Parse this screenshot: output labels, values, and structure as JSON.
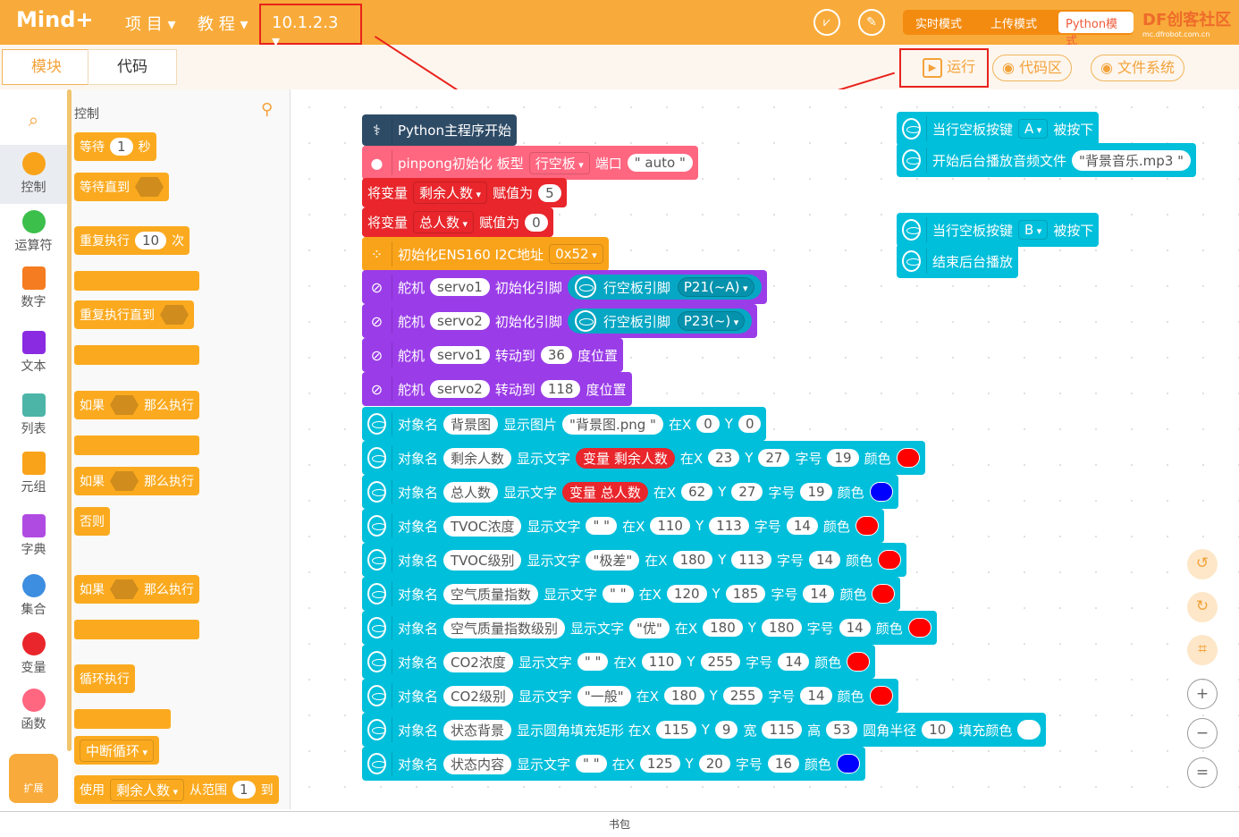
{
  "topbar": {
    "logo": "Mind+",
    "menu_project": "项 目 ▾",
    "menu_tutorial": "教 程 ▾",
    "version": "10.1.2.3 ▾",
    "modes": [
      "实时模式",
      "上传模式",
      "Python模式"
    ],
    "brand": "DF创客社区",
    "brand_url": "mc.dfrobot.com.cn"
  },
  "tabs": {
    "blocks": "模块",
    "code": "代码"
  },
  "toolbar": {
    "run": "运行",
    "code_area": "代码区",
    "file_system": "文件系统"
  },
  "categories": [
    {
      "label": "控制",
      "color": "#f9a31a"
    },
    {
      "label": "运算符",
      "color": "#3cbf4b"
    },
    {
      "label": "数字",
      "color": "#f57c20"
    },
    {
      "label": "文本",
      "color": "#8a2be2"
    },
    {
      "label": "列表",
      "color": "#4cb5a8"
    },
    {
      "label": "元组",
      "color": "#f9a31a"
    },
    {
      "label": "字典",
      "color": "#b04be2"
    },
    {
      "label": "集合",
      "color": "#3d8ee0"
    },
    {
      "label": "变量",
      "color": "#e8262b"
    },
    {
      "label": "函数",
      "color": "#ff6680"
    }
  ],
  "extensions_label": "扩展",
  "flyout": {
    "title": "控制",
    "blocks": [
      [
        {
          "t": "等待"
        },
        {
          "v": "1"
        },
        {
          "t": "秒"
        }
      ],
      [
        {
          "t": "等待直到"
        },
        {
          "h": ""
        }
      ],
      [
        {
          "t": "重复执行"
        },
        {
          "v": "10"
        },
        {
          "t": "次"
        }
      ],
      [
        {
          "t": "重复执行直到"
        },
        {
          "h": ""
        }
      ],
      [
        {
          "t": "如果"
        },
        {
          "h": ""
        },
        {
          "t": "那么执行"
        }
      ],
      [
        {
          "t": "如果"
        },
        {
          "h": ""
        },
        {
          "t": "那么执行"
        }
      ],
      [
        {
          "t": "否则"
        }
      ],
      [
        {
          "t": "如果"
        },
        {
          "h": ""
        },
        {
          "t": "那么执行"
        }
      ],
      [
        {
          "t": "循环执行"
        }
      ],
      [
        {
          "d": "中断循环"
        }
      ],
      [
        {
          "t": "使用"
        },
        {
          "d": "剩余人数"
        },
        {
          "t": "从范围"
        },
        {
          "v": "1"
        },
        {
          "t": "到"
        }
      ]
    ]
  },
  "colors": {
    "python": "#2e4b66",
    "pinpong": "#ff6680",
    "variable": "#e8262b",
    "ens": "#f9a31a",
    "servo": "#9a3ce8",
    "unihiker": "#00bfdb",
    "red": "#ff0000",
    "blue": "#0000ff",
    "white": "#ffffff"
  },
  "script": [
    {
      "kind": "python",
      "icon": "python-icon",
      "parts": [
        {
          "t": "Python主程序开始"
        }
      ]
    },
    {
      "kind": "pinpong",
      "icon": "pinpong-icon",
      "parts": [
        {
          "t": "pinpong初始化 板型"
        },
        {
          "d": "行空板"
        },
        {
          "t": "端口"
        },
        {
          "v": "\" auto \""
        }
      ]
    },
    {
      "kind": "variable",
      "parts": [
        {
          "t": "将变量"
        },
        {
          "d": "剩余人数"
        },
        {
          "t": "赋值为"
        },
        {
          "v": "5"
        }
      ]
    },
    {
      "kind": "variable",
      "parts": [
        {
          "t": "将变量"
        },
        {
          "d": "总人数"
        },
        {
          "t": "赋值为"
        },
        {
          "v": "0"
        }
      ]
    },
    {
      "kind": "ens",
      "icon": "sensor-icon",
      "parts": [
        {
          "t": "初始化ENS160 I2C地址"
        },
        {
          "d": "0x52"
        }
      ]
    },
    {
      "kind": "servo",
      "icon": "servo-icon",
      "parts": [
        {
          "t": "舵机"
        },
        {
          "v": "servo1"
        },
        {
          "t": "初始化引脚"
        },
        {
          "s": [
            "行空板引脚",
            "P21(~A)"
          ]
        }
      ]
    },
    {
      "kind": "servo",
      "icon": "servo-icon",
      "parts": [
        {
          "t": "舵机"
        },
        {
          "v": "servo2"
        },
        {
          "t": "初始化引脚"
        },
        {
          "s": [
            "行空板引脚",
            "P23(~)"
          ]
        }
      ]
    },
    {
      "kind": "servo",
      "icon": "servo-icon",
      "parts": [
        {
          "t": "舵机"
        },
        {
          "v": "servo1"
        },
        {
          "t": "转动到"
        },
        {
          "v": "36"
        },
        {
          "t": "度位置"
        }
      ]
    },
    {
      "kind": "servo",
      "icon": "servo-icon",
      "parts": [
        {
          "t": "舵机"
        },
        {
          "v": "servo2"
        },
        {
          "t": "转动到"
        },
        {
          "v": "118"
        },
        {
          "t": "度位置"
        }
      ]
    },
    {
      "kind": "unihiker",
      "icon": "unihiker-icon",
      "parts": [
        {
          "t": "对象名"
        },
        {
          "v": "背景图"
        },
        {
          "t": "显示图片"
        },
        {
          "v": "\"背景图.png \""
        },
        {
          "t": "在X"
        },
        {
          "v": "0"
        },
        {
          "t": "Y"
        },
        {
          "v": "0"
        }
      ]
    },
    {
      "kind": "unihiker",
      "icon": "unihiker-icon",
      "parts": [
        {
          "t": "对象名"
        },
        {
          "v": "剩余人数"
        },
        {
          "t": "显示文字"
        },
        {
          "r": "变量 剩余人数"
        },
        {
          "t": "在X"
        },
        {
          "v": "23"
        },
        {
          "t": "Y"
        },
        {
          "v": "27"
        },
        {
          "t": "字号"
        },
        {
          "v": "19"
        },
        {
          "t": "颜色"
        },
        {
          "c": "#ff0000"
        }
      ]
    },
    {
      "kind": "unihiker",
      "icon": "unihiker-icon",
      "parts": [
        {
          "t": "对象名"
        },
        {
          "v": "总人数"
        },
        {
          "t": "显示文字"
        },
        {
          "r": "变量 总人数"
        },
        {
          "t": "在X"
        },
        {
          "v": "62"
        },
        {
          "t": "Y"
        },
        {
          "v": "27"
        },
        {
          "t": "字号"
        },
        {
          "v": "19"
        },
        {
          "t": "颜色"
        },
        {
          "c": "#0000ff"
        }
      ]
    },
    {
      "kind": "unihiker",
      "icon": "unihiker-icon",
      "parts": [
        {
          "t": "对象名"
        },
        {
          "v": "TVOC浓度"
        },
        {
          "t": "显示文字"
        },
        {
          "v": "\"  \""
        },
        {
          "t": "在X"
        },
        {
          "v": "110"
        },
        {
          "t": "Y"
        },
        {
          "v": "113"
        },
        {
          "t": "字号"
        },
        {
          "v": "14"
        },
        {
          "t": "颜色"
        },
        {
          "c": "#ff0000"
        }
      ]
    },
    {
      "kind": "unihiker",
      "icon": "unihiker-icon",
      "parts": [
        {
          "t": "对象名"
        },
        {
          "v": "TVOC级别"
        },
        {
          "t": "显示文字"
        },
        {
          "v": "\"极差\""
        },
        {
          "t": "在X"
        },
        {
          "v": "180"
        },
        {
          "t": "Y"
        },
        {
          "v": "113"
        },
        {
          "t": "字号"
        },
        {
          "v": "14"
        },
        {
          "t": "颜色"
        },
        {
          "c": "#ff0000"
        }
      ]
    },
    {
      "kind": "unihiker",
      "icon": "unihiker-icon",
      "parts": [
        {
          "t": "对象名"
        },
        {
          "v": "空气质量指数"
        },
        {
          "t": "显示文字"
        },
        {
          "v": "\"  \""
        },
        {
          "t": "在X"
        },
        {
          "v": "120"
        },
        {
          "t": "Y"
        },
        {
          "v": "185"
        },
        {
          "t": "字号"
        },
        {
          "v": "14"
        },
        {
          "t": "颜色"
        },
        {
          "c": "#ff0000"
        }
      ]
    },
    {
      "kind": "unihiker",
      "icon": "unihiker-icon",
      "parts": [
        {
          "t": "对象名"
        },
        {
          "v": "空气质量指数级别"
        },
        {
          "t": "显示文字"
        },
        {
          "v": "\"优\""
        },
        {
          "t": "在X"
        },
        {
          "v": "180"
        },
        {
          "t": "Y"
        },
        {
          "v": "180"
        },
        {
          "t": "字号"
        },
        {
          "v": "14"
        },
        {
          "t": "颜色"
        },
        {
          "c": "#ff0000"
        }
      ]
    },
    {
      "kind": "unihiker",
      "icon": "unihiker-icon",
      "parts": [
        {
          "t": "对象名"
        },
        {
          "v": "CO2浓度"
        },
        {
          "t": "显示文字"
        },
        {
          "v": "\"  \""
        },
        {
          "t": "在X"
        },
        {
          "v": "110"
        },
        {
          "t": "Y"
        },
        {
          "v": "255"
        },
        {
          "t": "字号"
        },
        {
          "v": "14"
        },
        {
          "t": "颜色"
        },
        {
          "c": "#ff0000"
        }
      ]
    },
    {
      "kind": "unihiker",
      "icon": "unihiker-icon",
      "parts": [
        {
          "t": "对象名"
        },
        {
          "v": "CO2级别"
        },
        {
          "t": "显示文字"
        },
        {
          "v": "\"一般\""
        },
        {
          "t": "在X"
        },
        {
          "v": "180"
        },
        {
          "t": "Y"
        },
        {
          "v": "255"
        },
        {
          "t": "字号"
        },
        {
          "v": "14"
        },
        {
          "t": "颜色"
        },
        {
          "c": "#ff0000"
        }
      ]
    },
    {
      "kind": "unihiker",
      "icon": "unihiker-icon",
      "parts": [
        {
          "t": "对象名"
        },
        {
          "v": "状态背景"
        },
        {
          "t": "显示圆角填充矩形 在X"
        },
        {
          "v": "115"
        },
        {
          "t": "Y"
        },
        {
          "v": "9"
        },
        {
          "t": "宽"
        },
        {
          "v": "115"
        },
        {
          "t": "高"
        },
        {
          "v": "53"
        },
        {
          "t": "圆角半径"
        },
        {
          "v": "10"
        },
        {
          "t": "填充颜色"
        },
        {
          "c": "#ffffff"
        }
      ]
    },
    {
      "kind": "unihiker",
      "icon": "unihiker-icon",
      "parts": [
        {
          "t": "对象名"
        },
        {
          "v": "状态内容"
        },
        {
          "t": "显示文字"
        },
        {
          "v": "\"  \""
        },
        {
          "t": "在X"
        },
        {
          "v": "125"
        },
        {
          "t": "Y"
        },
        {
          "v": "20"
        },
        {
          "t": "字号"
        },
        {
          "v": "16"
        },
        {
          "t": "颜色"
        },
        {
          "c": "#0000ff"
        }
      ]
    }
  ],
  "events": [
    {
      "kind": "unihiker",
      "icon": "unihiker-icon",
      "parts": [
        {
          "t": "当行空板按键"
        },
        {
          "d": "A"
        },
        {
          "t": "被按下"
        }
      ]
    },
    {
      "kind": "unihiker",
      "icon": "unihiker-icon",
      "parts": [
        {
          "t": "开始后台播放音频文件"
        },
        {
          "v": "\"背景音乐.mp3 \""
        }
      ]
    },
    {
      "kind": "unihiker",
      "icon": "unihiker-icon",
      "parts": [
        {
          "t": "当行空板按键"
        },
        {
          "d": "B"
        },
        {
          "t": "被按下"
        }
      ]
    },
    {
      "kind": "unihiker",
      "icon": "unihiker-icon",
      "parts": [
        {
          "t": "结束后台播放"
        }
      ]
    }
  ],
  "bottom": {
    "backpack": "书包"
  }
}
